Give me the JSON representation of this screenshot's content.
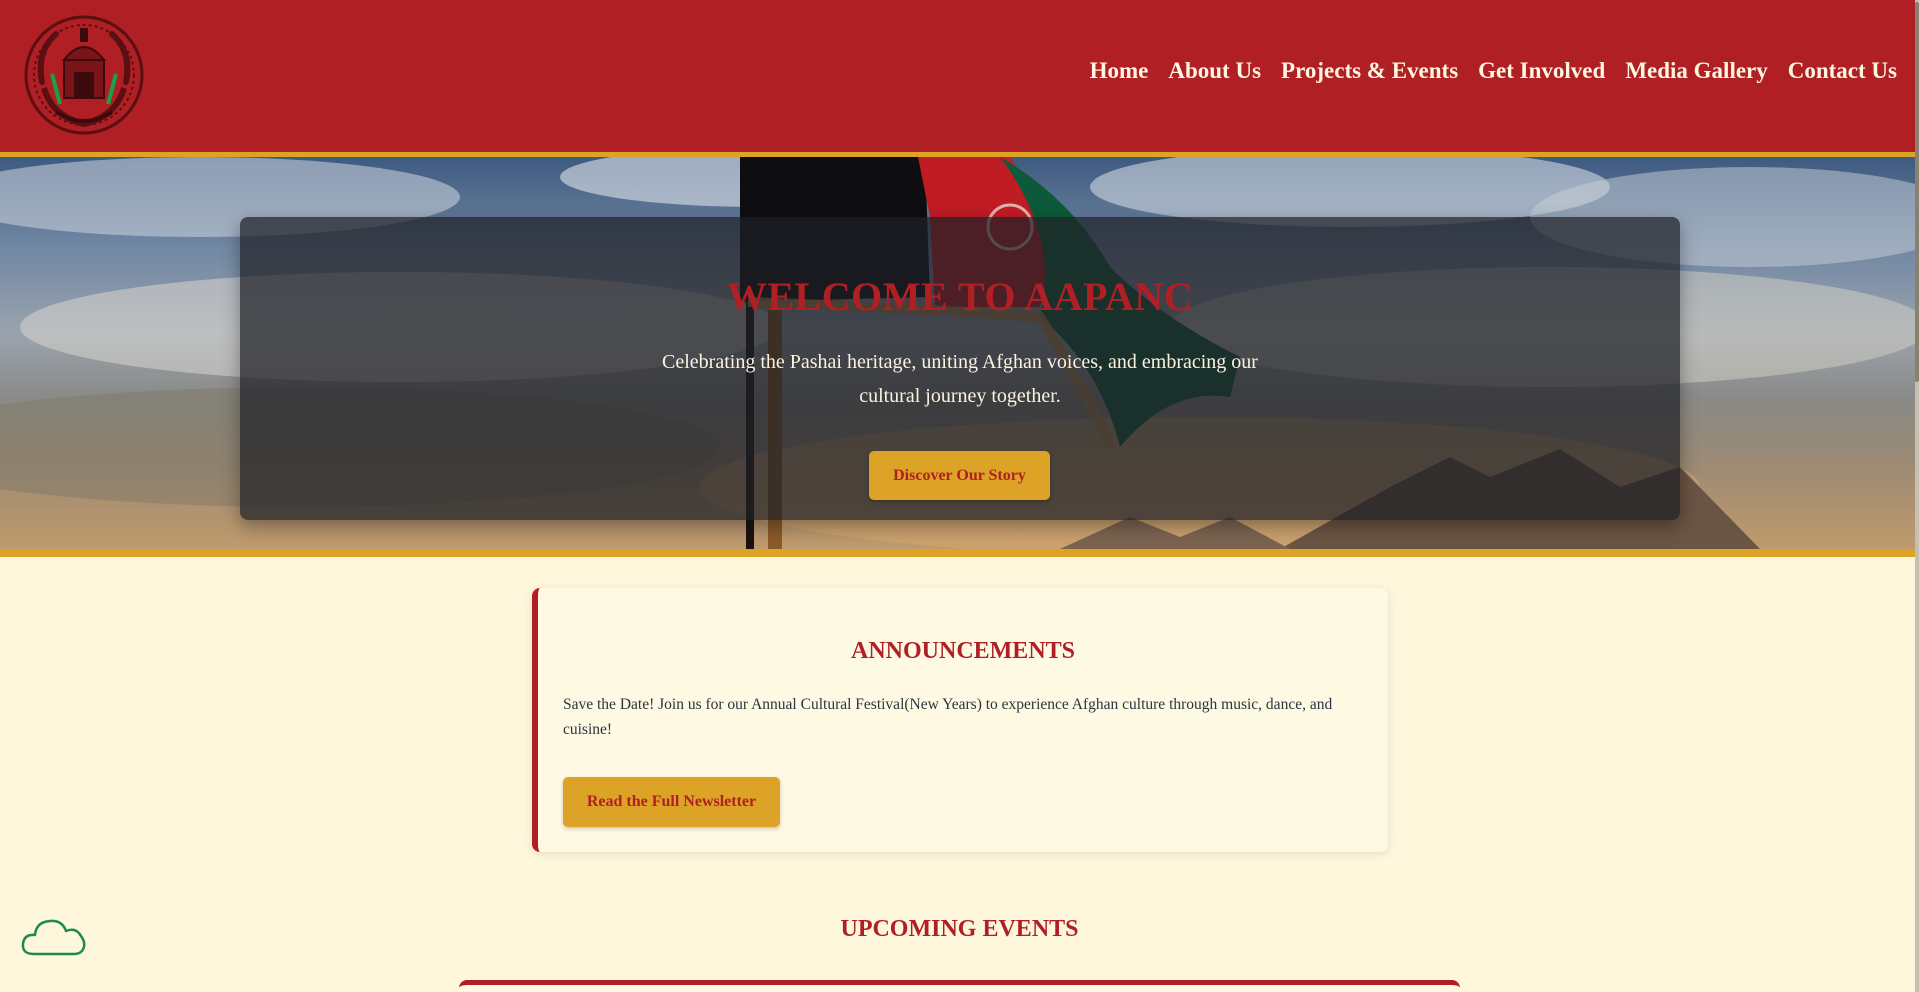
{
  "header": {
    "logo_icon": "afghan-emblem-icon",
    "nav": [
      {
        "label": "Home"
      },
      {
        "label": "About Us"
      },
      {
        "label": "Projects & Events"
      },
      {
        "label": "Get Involved"
      },
      {
        "label": "Media Gallery"
      },
      {
        "label": "Contact Us"
      }
    ]
  },
  "hero": {
    "title": "WELCOME TO AAPANC",
    "subtitle": "Celebrating the Pashai heritage, uniting Afghan voices, and embracing our cultural journey together.",
    "button_label": "Discover Our Story"
  },
  "announcements": {
    "title": "ANNOUNCEMENTS",
    "text": "Save the Date! Join us for our Annual Cultural Festival(New Years) to experience Afghan culture through music, dance, and cuisine!",
    "button_label": "Read the Full Newsletter"
  },
  "events": {
    "title": "UPCOMING EVENTS"
  },
  "widgets": {
    "cloud_icon": "cloud-icon"
  },
  "colors": {
    "primary_red": "#b01f24",
    "accent_gold": "#dca327",
    "page_bg": "#fef7dc"
  }
}
